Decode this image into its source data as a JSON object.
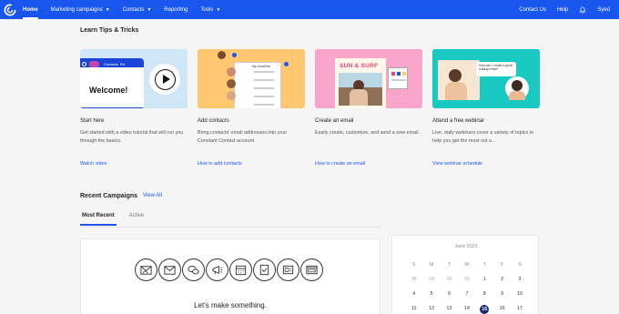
{
  "nav": {
    "items": [
      {
        "label": "Home",
        "active": true,
        "dropdown": false
      },
      {
        "label": "Marketing campaigns",
        "active": false,
        "dropdown": true
      },
      {
        "label": "Contacts",
        "active": false,
        "dropdown": true
      },
      {
        "label": "Reporting",
        "active": false,
        "dropdown": false
      },
      {
        "label": "Tools",
        "active": false,
        "dropdown": true
      }
    ],
    "right": {
      "contact_us": "Contact Us",
      "help": "Help",
      "user": "Syed"
    }
  },
  "tips": {
    "title": "Learn Tips & Tricks",
    "cards": [
      {
        "title": "Start here",
        "description": "Get started with a video tutorial that will run you through the basics.",
        "link": "Watch video",
        "thumb_text": "Welcome!",
        "thumb_tab1": "Contacts",
        "thumb_tab2": "Re"
      },
      {
        "title": "Add contacts",
        "description": "Bring contacts' email addresses into your Constant Contact account.",
        "link": "How to add contacts",
        "thumb_text": "My email list"
      },
      {
        "title": "Create an email",
        "description": "Easily create, customize, and send a new email.",
        "link": "How to create an email",
        "thumb_text": "SUN & SURF"
      },
      {
        "title": "Attend a free webinar",
        "description": "Live, daily webinars cover a variety of topics to help you get the most out o...",
        "link": "View webinar schedule",
        "thumb_text": "How can I create a great holiday email?"
      }
    ]
  },
  "recent": {
    "title": "Recent Campaigns",
    "view_all": "View All",
    "tabs": [
      "Most Recent",
      "Active"
    ],
    "empty_message": "Let's make something."
  },
  "calendar": {
    "month": "June 2023",
    "headers": [
      "S",
      "M",
      "T",
      "W",
      "T",
      "F",
      "S"
    ],
    "rows": [
      [
        "28",
        "29",
        "30",
        "31",
        "1",
        "2",
        "3"
      ],
      [
        "4",
        "5",
        "6",
        "7",
        "8",
        "9",
        "10"
      ],
      [
        "11",
        "12",
        "13",
        "14",
        "15",
        "16",
        "17"
      ]
    ],
    "today": "15"
  },
  "colors": {
    "brand_blue": "#1856ed",
    "calendar_today": "#15296f"
  }
}
